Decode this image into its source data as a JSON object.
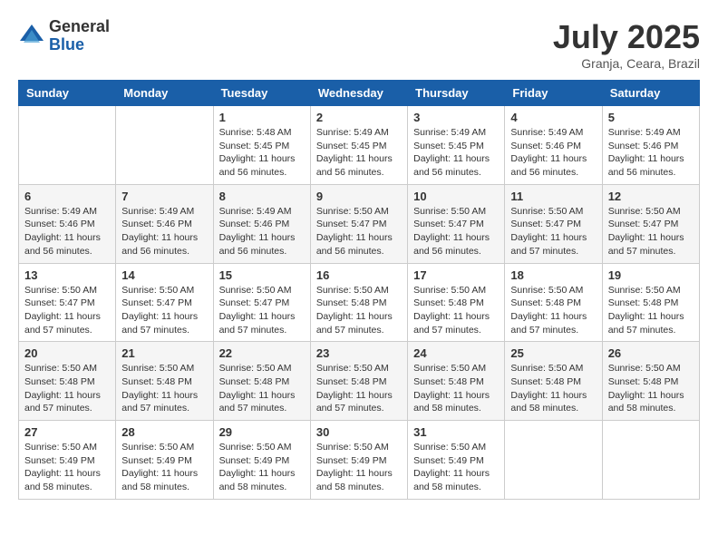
{
  "logo": {
    "general": "General",
    "blue": "Blue"
  },
  "header": {
    "month": "July 2025",
    "location": "Granja, Ceara, Brazil"
  },
  "days_of_week": [
    "Sunday",
    "Monday",
    "Tuesday",
    "Wednesday",
    "Thursday",
    "Friday",
    "Saturday"
  ],
  "weeks": [
    [
      {
        "day": "",
        "info": ""
      },
      {
        "day": "",
        "info": ""
      },
      {
        "day": "1",
        "info": "Sunrise: 5:48 AM\nSunset: 5:45 PM\nDaylight: 11 hours and 56 minutes."
      },
      {
        "day": "2",
        "info": "Sunrise: 5:49 AM\nSunset: 5:45 PM\nDaylight: 11 hours and 56 minutes."
      },
      {
        "day": "3",
        "info": "Sunrise: 5:49 AM\nSunset: 5:45 PM\nDaylight: 11 hours and 56 minutes."
      },
      {
        "day": "4",
        "info": "Sunrise: 5:49 AM\nSunset: 5:46 PM\nDaylight: 11 hours and 56 minutes."
      },
      {
        "day": "5",
        "info": "Sunrise: 5:49 AM\nSunset: 5:46 PM\nDaylight: 11 hours and 56 minutes."
      }
    ],
    [
      {
        "day": "6",
        "info": "Sunrise: 5:49 AM\nSunset: 5:46 PM\nDaylight: 11 hours and 56 minutes."
      },
      {
        "day": "7",
        "info": "Sunrise: 5:49 AM\nSunset: 5:46 PM\nDaylight: 11 hours and 56 minutes."
      },
      {
        "day": "8",
        "info": "Sunrise: 5:49 AM\nSunset: 5:46 PM\nDaylight: 11 hours and 56 minutes."
      },
      {
        "day": "9",
        "info": "Sunrise: 5:50 AM\nSunset: 5:47 PM\nDaylight: 11 hours and 56 minutes."
      },
      {
        "day": "10",
        "info": "Sunrise: 5:50 AM\nSunset: 5:47 PM\nDaylight: 11 hours and 56 minutes."
      },
      {
        "day": "11",
        "info": "Sunrise: 5:50 AM\nSunset: 5:47 PM\nDaylight: 11 hours and 57 minutes."
      },
      {
        "day": "12",
        "info": "Sunrise: 5:50 AM\nSunset: 5:47 PM\nDaylight: 11 hours and 57 minutes."
      }
    ],
    [
      {
        "day": "13",
        "info": "Sunrise: 5:50 AM\nSunset: 5:47 PM\nDaylight: 11 hours and 57 minutes."
      },
      {
        "day": "14",
        "info": "Sunrise: 5:50 AM\nSunset: 5:47 PM\nDaylight: 11 hours and 57 minutes."
      },
      {
        "day": "15",
        "info": "Sunrise: 5:50 AM\nSunset: 5:47 PM\nDaylight: 11 hours and 57 minutes."
      },
      {
        "day": "16",
        "info": "Sunrise: 5:50 AM\nSunset: 5:48 PM\nDaylight: 11 hours and 57 minutes."
      },
      {
        "day": "17",
        "info": "Sunrise: 5:50 AM\nSunset: 5:48 PM\nDaylight: 11 hours and 57 minutes."
      },
      {
        "day": "18",
        "info": "Sunrise: 5:50 AM\nSunset: 5:48 PM\nDaylight: 11 hours and 57 minutes."
      },
      {
        "day": "19",
        "info": "Sunrise: 5:50 AM\nSunset: 5:48 PM\nDaylight: 11 hours and 57 minutes."
      }
    ],
    [
      {
        "day": "20",
        "info": "Sunrise: 5:50 AM\nSunset: 5:48 PM\nDaylight: 11 hours and 57 minutes."
      },
      {
        "day": "21",
        "info": "Sunrise: 5:50 AM\nSunset: 5:48 PM\nDaylight: 11 hours and 57 minutes."
      },
      {
        "day": "22",
        "info": "Sunrise: 5:50 AM\nSunset: 5:48 PM\nDaylight: 11 hours and 57 minutes."
      },
      {
        "day": "23",
        "info": "Sunrise: 5:50 AM\nSunset: 5:48 PM\nDaylight: 11 hours and 57 minutes."
      },
      {
        "day": "24",
        "info": "Sunrise: 5:50 AM\nSunset: 5:48 PM\nDaylight: 11 hours and 58 minutes."
      },
      {
        "day": "25",
        "info": "Sunrise: 5:50 AM\nSunset: 5:48 PM\nDaylight: 11 hours and 58 minutes."
      },
      {
        "day": "26",
        "info": "Sunrise: 5:50 AM\nSunset: 5:48 PM\nDaylight: 11 hours and 58 minutes."
      }
    ],
    [
      {
        "day": "27",
        "info": "Sunrise: 5:50 AM\nSunset: 5:49 PM\nDaylight: 11 hours and 58 minutes."
      },
      {
        "day": "28",
        "info": "Sunrise: 5:50 AM\nSunset: 5:49 PM\nDaylight: 11 hours and 58 minutes."
      },
      {
        "day": "29",
        "info": "Sunrise: 5:50 AM\nSunset: 5:49 PM\nDaylight: 11 hours and 58 minutes."
      },
      {
        "day": "30",
        "info": "Sunrise: 5:50 AM\nSunset: 5:49 PM\nDaylight: 11 hours and 58 minutes."
      },
      {
        "day": "31",
        "info": "Sunrise: 5:50 AM\nSunset: 5:49 PM\nDaylight: 11 hours and 58 minutes."
      },
      {
        "day": "",
        "info": ""
      },
      {
        "day": "",
        "info": ""
      }
    ]
  ]
}
